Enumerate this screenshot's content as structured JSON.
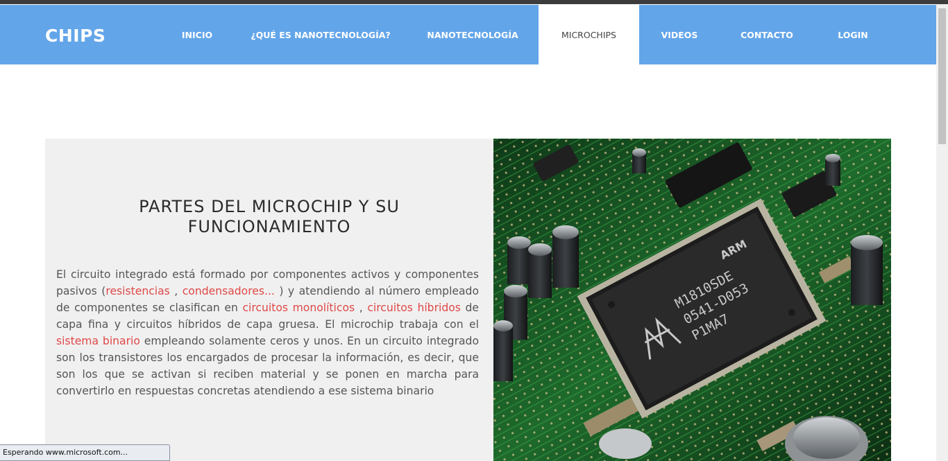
{
  "brand": "CHIPS",
  "nav": {
    "items": [
      {
        "label": "INICIO"
      },
      {
        "label": "¿QUÉ ES NANOTECNOLOGÍA?"
      },
      {
        "label": "NANOTECNOLOGÍA"
      },
      {
        "label": "MICROCHIPS"
      },
      {
        "label": "VIDEOS"
      },
      {
        "label": "CONTACTO"
      },
      {
        "label": "LOGIN"
      }
    ],
    "active": "MICROCHIPS"
  },
  "section": {
    "title_line1": "PARTES DEL MICROCHIP Y SU",
    "title_line2": "FUNCIONAMIENTO",
    "paragraph": {
      "t1": "El circuito integrado está formado por componentes activos y componentes pasivos (",
      "link_resistencias": "resistencias",
      "t2": " , ",
      "link_condensadores": "condensadores...",
      "t3": " ) y atendiendo al número empleado de componentes se clasifican en ",
      "link_monoliticos": "circuitos monolíticos",
      "t4": " , ",
      "link_hibridos": "circuitos híbridos",
      "t5": " de capa fina y circuitos híbridos de capa gruesa. El microchip trabaja con el ",
      "link_binario": "sistema binario",
      "t6": " empleando solamente ceros y unos. En un circuito integrado son los transistores los encargados de procesar la información, es decir, que son los que se activan si reciben material y se ponen en marcha para convertirlo en respuestas concretas atendiendo a ese sistema binario"
    }
  },
  "image": {
    "chip_marking_line1": "ARM",
    "chip_marking_line2": "M1810SDE",
    "chip_marking_line3": "0541-D053",
    "chip_marking_line4": "P1MA7"
  },
  "status": {
    "text": "Esperando www.microsoft.com..."
  },
  "colors": {
    "navbar": "#63a5e9",
    "link": "#e04848",
    "content_bg": "#f0f0f0"
  }
}
